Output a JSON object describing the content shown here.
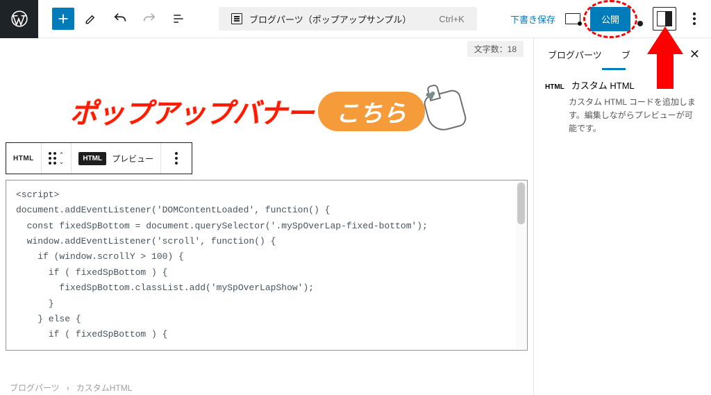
{
  "topbar": {
    "document_title": "ブログパーツ（ポップアップサンプル）",
    "shortcut": "Ctrl+K",
    "save_draft": "下書き保存",
    "publish": "公開"
  },
  "canvas": {
    "char_count_label": "文字数：18",
    "banner_text": "ポップアップバナー",
    "banner_cta": "こちら"
  },
  "block_toolbar": {
    "html_label": "HTML",
    "html_mode": "HTML",
    "preview": "プレビュー"
  },
  "code": "<script>\ndocument.addEventListener('DOMContentLoaded', function() {\n  const fixedSpBottom = document.querySelector('.mySpOverLap-fixed-bottom');\n  window.addEventListener('scroll', function() {\n    if (window.scrollY > 100) {\n      if ( fixedSpBottom ) {\n        fixedSpBottom.classList.add('mySpOverLapShow');\n      }\n    } else {\n      if ( fixedSpBottom ) {",
  "breadcrumb": {
    "root": "ブログパーツ",
    "sep": "›",
    "leaf": "カスタムHTML"
  },
  "sidebar": {
    "tab1": "ブログパーツ",
    "tab2": "ブ",
    "block_badge": "HTML",
    "block_title": "カスタム HTML",
    "block_desc": "カスタム HTML コードを追加します。編集しながらプレビューが可能です。"
  }
}
